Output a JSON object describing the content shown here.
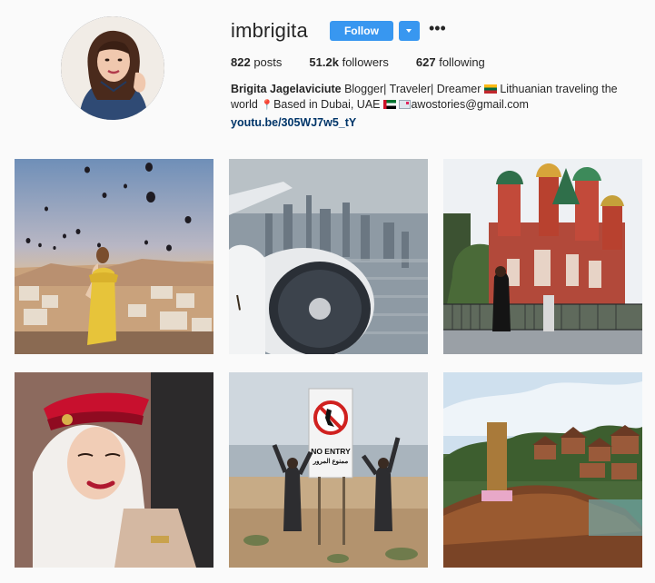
{
  "profile": {
    "username": "imbrigita",
    "follow_label": "Follow",
    "dropdown_icon": "chevron-down-icon",
    "more_icon": "ellipsis-icon",
    "more_label": "•••"
  },
  "stats": {
    "posts_value": "822",
    "posts_label": "posts",
    "followers_value": "51.2k",
    "followers_label": "followers",
    "following_value": "627",
    "following_label": "following"
  },
  "bio": {
    "full_name": "Brigita Jagelaviciute",
    "text_part1": "Blogger| Traveler| Dreamer",
    "text_part2": "Lithuanian traveling the world",
    "text_part3": "Based in Dubai, UAE",
    "text_part4": "awostories@gmail.com",
    "link": "youtu.be/305WJ7w5_tY"
  },
  "posts": [
    {
      "scene": "hot air balloons over town at sunrise, woman in yellow dress"
    },
    {
      "scene": "aerial view of Dubai skyline from airplane window with engine"
    },
    {
      "scene": "St. Basil's Cathedral, woman standing by fence"
    },
    {
      "scene": "flight attendant with red hat and white veil"
    },
    {
      "scene": "two people posing next to NO ENTRY sign in desert",
      "sign_text": "NO ENTRY",
      "sign_text_ar": "ممنوع المرور"
    },
    {
      "scene": "wooden long-tail boat bow with tropical resort"
    }
  ]
}
